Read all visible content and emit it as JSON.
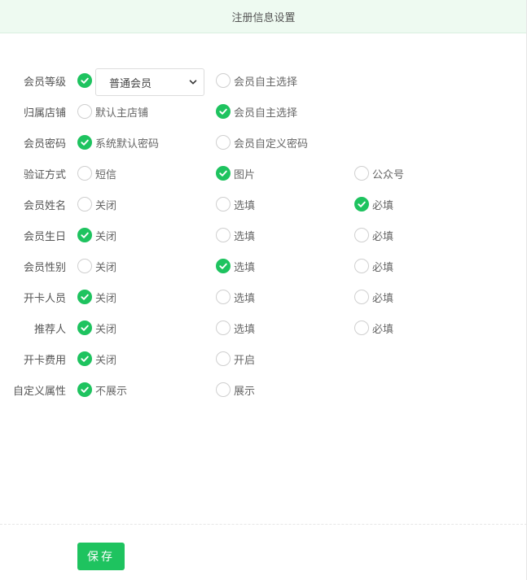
{
  "header": {
    "title": "注册信息设置"
  },
  "form": {
    "rows": [
      {
        "label": "会员等级",
        "select": {
          "value": "普通会员"
        },
        "options": [
          {
            "label": "",
            "checked": true
          },
          {
            "label": "会员自主选择",
            "checked": false
          }
        ]
      },
      {
        "label": "归属店铺",
        "options": [
          {
            "label": "默认主店铺",
            "checked": false
          },
          {
            "label": "会员自主选择",
            "checked": true
          }
        ]
      },
      {
        "label": "会员密码",
        "options": [
          {
            "label": "系统默认密码",
            "checked": true
          },
          {
            "label": "会员自定义密码",
            "checked": false
          }
        ]
      },
      {
        "label": "验证方式",
        "options": [
          {
            "label": "短信",
            "checked": false
          },
          {
            "label": "图片",
            "checked": true
          },
          {
            "label": "公众号",
            "checked": false
          }
        ]
      },
      {
        "label": "会员姓名",
        "options": [
          {
            "label": "关闭",
            "checked": false
          },
          {
            "label": "选填",
            "checked": false
          },
          {
            "label": "必填",
            "checked": true
          }
        ]
      },
      {
        "label": "会员生日",
        "options": [
          {
            "label": "关闭",
            "checked": true
          },
          {
            "label": "选填",
            "checked": false
          },
          {
            "label": "必填",
            "checked": false
          }
        ]
      },
      {
        "label": "会员性别",
        "options": [
          {
            "label": "关闭",
            "checked": false
          },
          {
            "label": "选填",
            "checked": true
          },
          {
            "label": "必填",
            "checked": false
          }
        ]
      },
      {
        "label": "开卡人员",
        "options": [
          {
            "label": "关闭",
            "checked": true
          },
          {
            "label": "选填",
            "checked": false
          },
          {
            "label": "必填",
            "checked": false
          }
        ]
      },
      {
        "label": "推荐人",
        "options": [
          {
            "label": "关闭",
            "checked": true
          },
          {
            "label": "选填",
            "checked": false
          },
          {
            "label": "必填",
            "checked": false
          }
        ]
      },
      {
        "label": "开卡费用",
        "options": [
          {
            "label": "关闭",
            "checked": true
          },
          {
            "label": "开启",
            "checked": false
          }
        ]
      },
      {
        "label": "自定义属性",
        "options": [
          {
            "label": "不展示",
            "checked": true
          },
          {
            "label": "展示",
            "checked": false
          }
        ]
      }
    ]
  },
  "actions": {
    "save_label": "保存"
  },
  "colors": {
    "accent": "#1ec35f",
    "header_bg": "#eefaf1",
    "radio_border": "#cfcfcf"
  },
  "icons": {
    "check": "check-icon",
    "dropdown": "chevron-down-icon"
  }
}
